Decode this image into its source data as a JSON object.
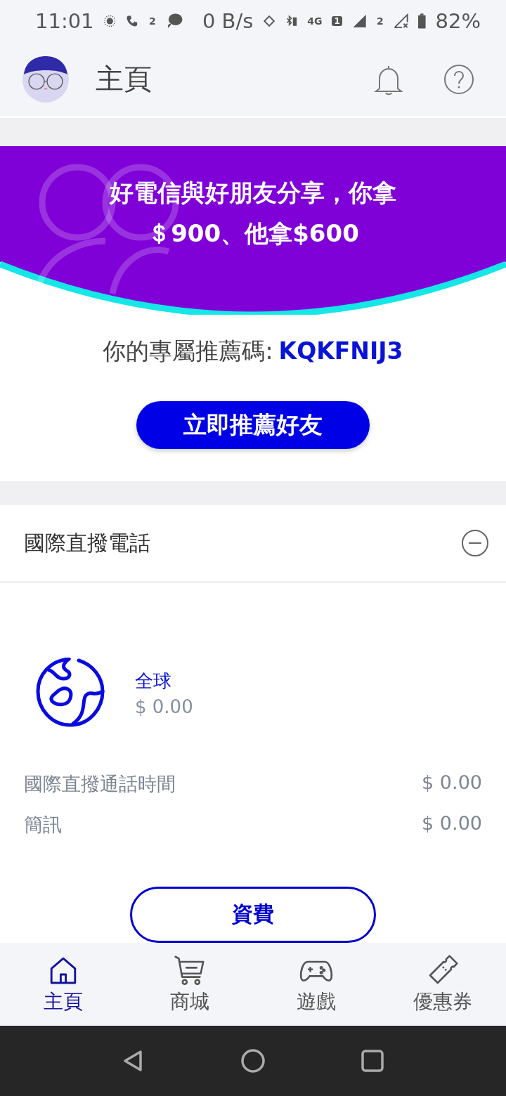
{
  "status_bar": {
    "time": "11:01",
    "call_badge": "2",
    "net_speed": "0 B/s",
    "network": "4G",
    "sim1_badge": "1",
    "sim2_badge": "2",
    "battery": "82%"
  },
  "header": {
    "title": "主頁"
  },
  "banner": {
    "lines": [
      "好電信與好朋友分享，你拿",
      "＄900、他拿$600"
    ]
  },
  "referral": {
    "label": "你的專屬推薦碼:",
    "code": "KQKFNIJ3",
    "button": "立即推薦好友"
  },
  "section": {
    "title": "國際直撥電話",
    "expanded": true,
    "plan": {
      "name": "全球",
      "price": "$ 0.00"
    },
    "items": [
      {
        "label": "國際直撥通話時間",
        "value": "$ 0.00"
      },
      {
        "label": "簡訊",
        "value": "$ 0.00"
      }
    ],
    "button": "資費"
  },
  "nav": [
    {
      "label": "主頁",
      "kind": "home",
      "selected": true
    },
    {
      "label": "商城",
      "kind": "cart",
      "selected": false
    },
    {
      "label": "遊戲",
      "kind": "game",
      "selected": false
    },
    {
      "label": "優惠券",
      "kind": "ticket",
      "selected": false
    }
  ]
}
